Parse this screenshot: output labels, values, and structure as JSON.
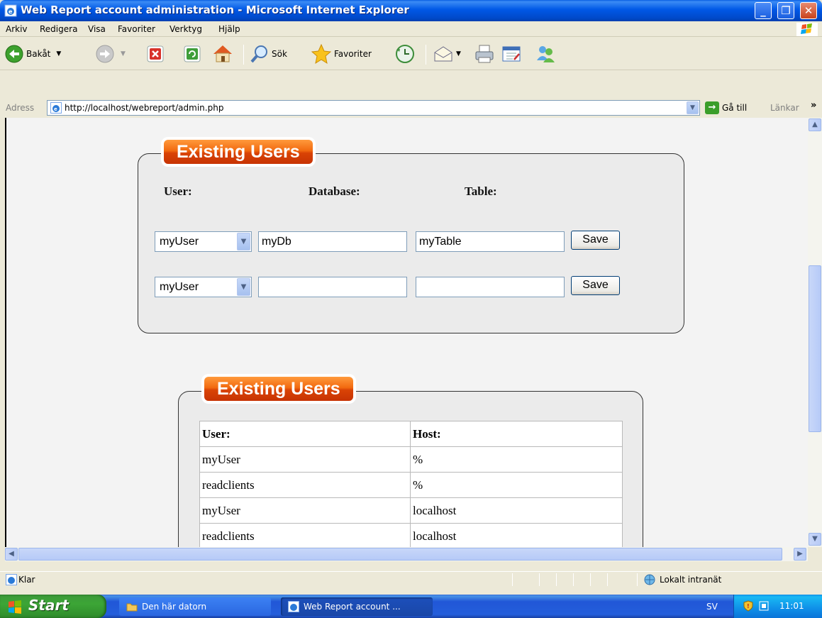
{
  "window": {
    "title": "Web Report account administration - Microsoft Internet Explorer"
  },
  "menu": [
    "Arkiv",
    "Redigera",
    "Visa",
    "Favoriter",
    "Verktyg",
    "Hjälp"
  ],
  "toolbar": {
    "back_label": "Bakåt",
    "search_label": "Sök",
    "favorites_label": "Favoriter"
  },
  "address": {
    "label": "Adress",
    "url": "http://localhost/webreport/admin.php",
    "go_label": "Gå till",
    "links_label": "Länkar"
  },
  "panel1": {
    "title": "Existing Users",
    "headers": {
      "user": "User:",
      "database": "Database:",
      "table": "Table:"
    },
    "rows": [
      {
        "user": "myUser",
        "database": "myDb",
        "table": "myTable",
        "button": "Save"
      },
      {
        "user": "myUser",
        "database": "",
        "table": "",
        "button": "Save"
      }
    ]
  },
  "panel2": {
    "title": "Existing Users",
    "headers": {
      "user": "User:",
      "host": "Host:"
    },
    "rows": [
      {
        "user": "myUser",
        "host": "%"
      },
      {
        "user": "readclients",
        "host": "%"
      },
      {
        "user": "myUser",
        "host": "localhost"
      },
      {
        "user": "readclients",
        "host": "localhost"
      }
    ]
  },
  "status": {
    "text": "Klar",
    "zone": "Lokalt intranät"
  },
  "taskbar": {
    "start_label": "Start",
    "tasks": [
      "Den här datorn",
      "Web Report account ..."
    ],
    "language": "SV",
    "clock": "11:01"
  }
}
